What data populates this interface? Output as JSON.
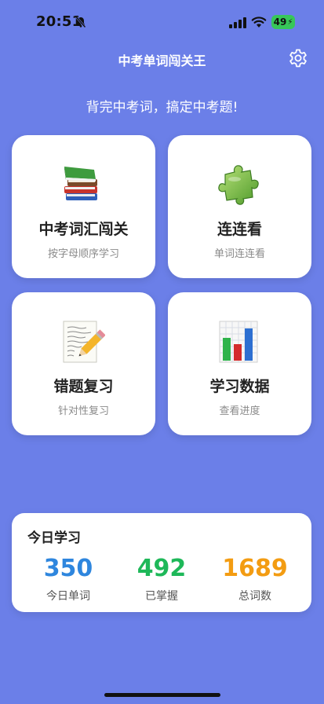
{
  "status_bar": {
    "time": "20:51",
    "battery": "49"
  },
  "header": {
    "title": "中考单词闯关王"
  },
  "slogan": "背完中考词，搞定中考题!",
  "cards": [
    {
      "title": "中考词汇闯关",
      "subtitle": "按字母顺序学习",
      "icon": "books-icon"
    },
    {
      "title": "连连看",
      "subtitle": "单词连连看",
      "icon": "puzzle-piece-icon"
    },
    {
      "title": "错题复习",
      "subtitle": "针对性复习",
      "icon": "memo-pencil-icon"
    },
    {
      "title": "学习数据",
      "subtitle": "查看进度",
      "icon": "bar-chart-icon"
    }
  ],
  "today": {
    "title": "今日学习",
    "stats": [
      {
        "value": "350",
        "label": "今日单词",
        "color": "#2E86DE"
      },
      {
        "value": "492",
        "label": "已掌握",
        "color": "#1EB859"
      },
      {
        "value": "1689",
        "label": "总词数",
        "color": "#F39C12"
      }
    ]
  },
  "colors": {
    "background": "#6B7FE8",
    "card": "#FFFFFF",
    "battery": "#37C759"
  }
}
